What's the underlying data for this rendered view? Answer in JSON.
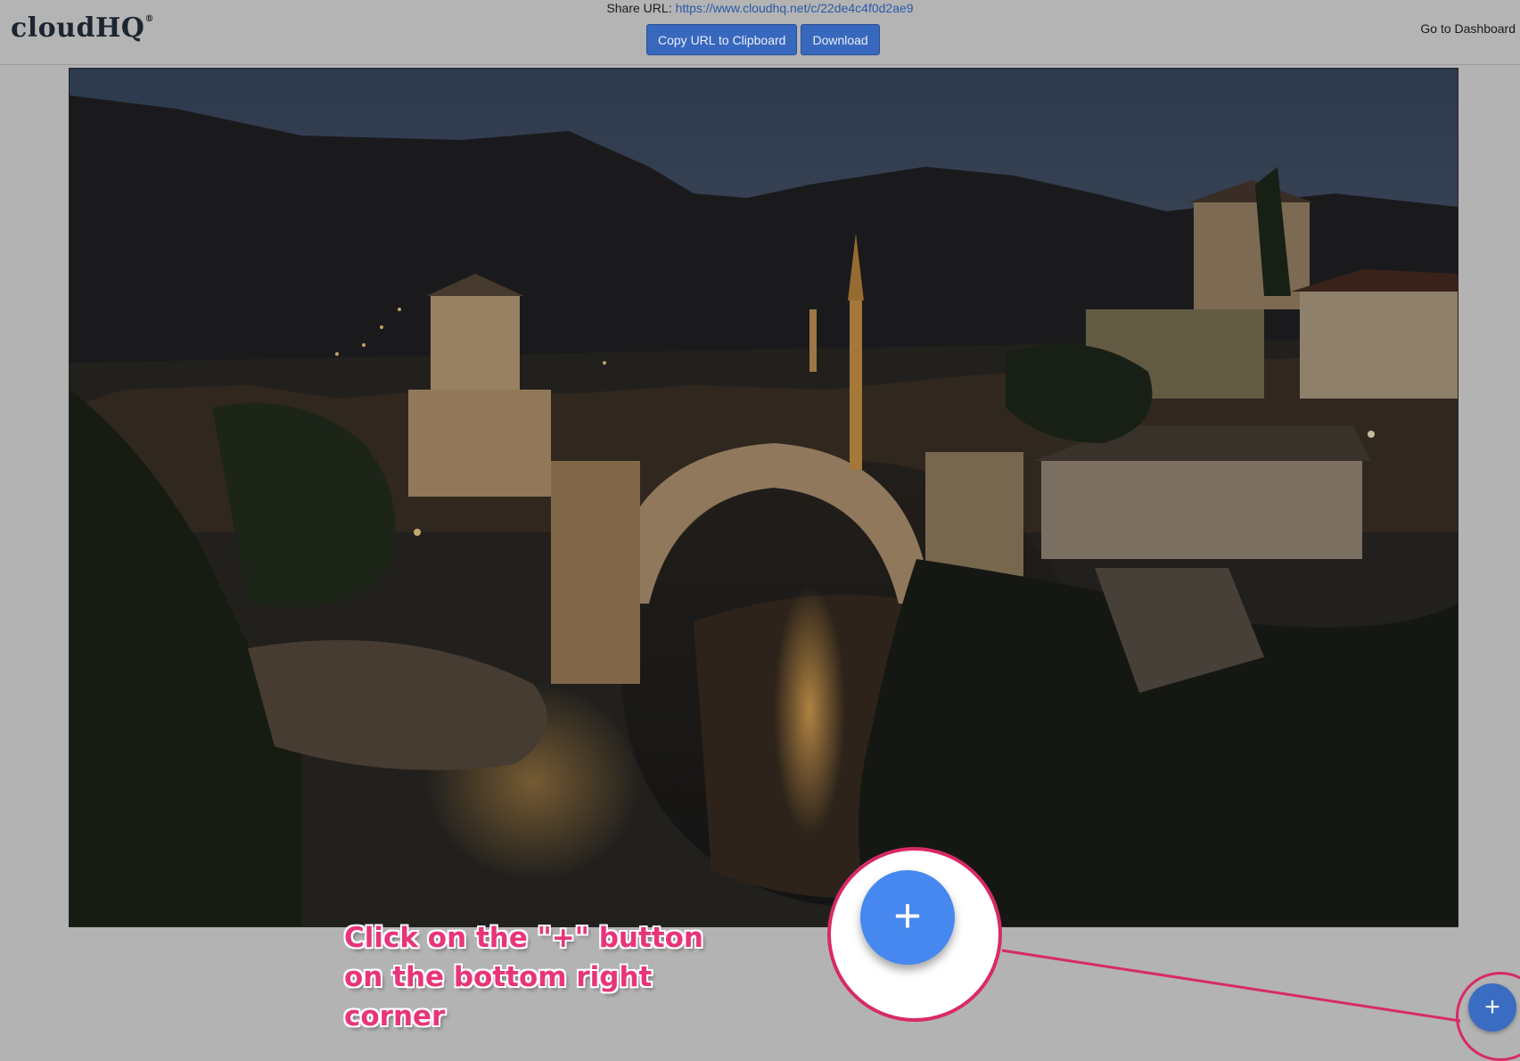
{
  "header": {
    "logo_text": "cloudHQ",
    "logo_mark": "®",
    "share_label": "Share URL:",
    "share_url": "https://www.cloudhq.net/c/22de4c4f0d2ae9",
    "copy_button": "Copy URL to Clipboard",
    "download_button": "Download",
    "dashboard_link": "Go to Dashboard"
  },
  "annotation": {
    "line1": "Click on the \"+\" button",
    "line2": "on the bottom right",
    "line3": "corner",
    "color": "#e8357a"
  },
  "fab": {
    "label": "+",
    "color": "#3a6cc2"
  },
  "zoom": {
    "label": "+",
    "color": "#4688f0"
  }
}
